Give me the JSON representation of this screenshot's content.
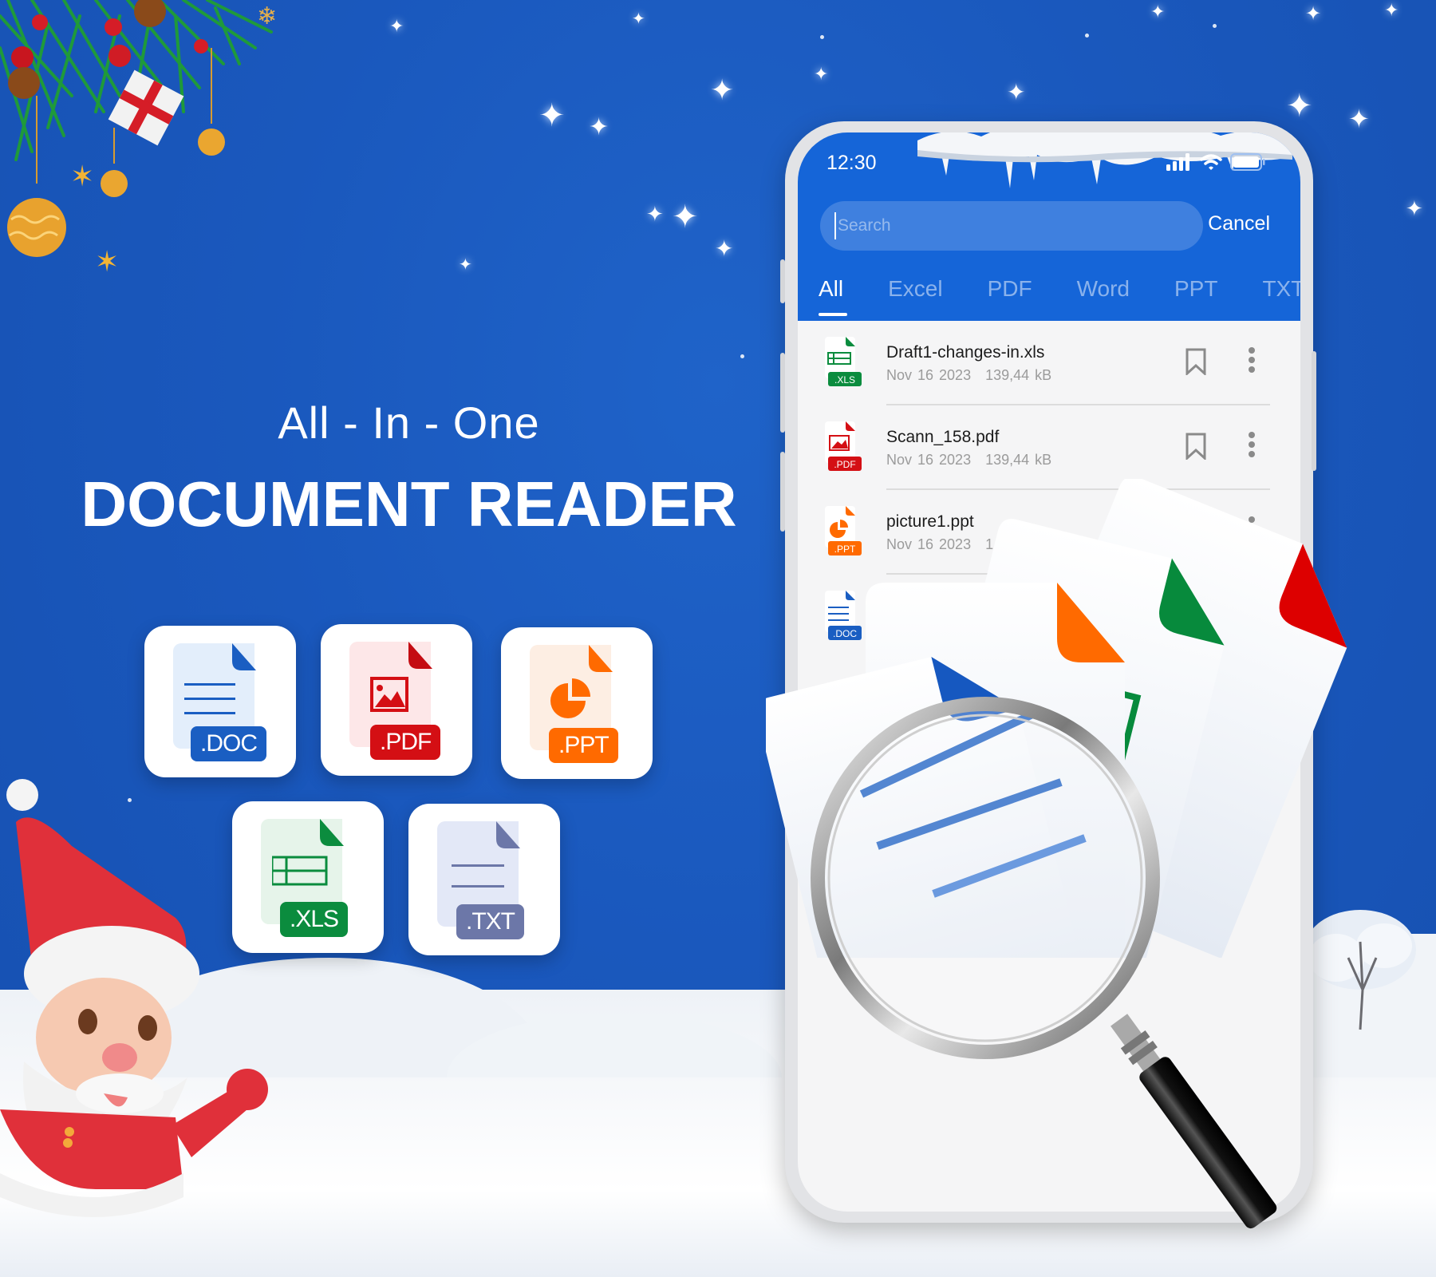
{
  "promo": {
    "tagline": "All - In - One",
    "headline": "DOCUMENT READER"
  },
  "formats": [
    {
      "label": ".DOC",
      "type": "doc",
      "color": "#1a5ec2",
      "tint": "#e3eefb"
    },
    {
      "label": ".PDF",
      "type": "pdf",
      "color": "#d40f14",
      "tint": "#fde7e8"
    },
    {
      "label": ".PPT",
      "type": "ppt",
      "color": "#ff6a00",
      "tint": "#fdeee3"
    },
    {
      "label": ".XLS",
      "type": "xls",
      "color": "#0b8c3e",
      "tint": "#e6f4ea"
    },
    {
      "label": ".TXT",
      "type": "txt",
      "color": "#6c77a8",
      "tint": "#e3e8f7"
    }
  ],
  "phone": {
    "status": {
      "time": "12:30",
      "icons": [
        "signal-icon",
        "wifi-icon",
        "battery-icon"
      ]
    },
    "search": {
      "placeholder": "Search",
      "value": "",
      "cancel_label": "Cancel"
    },
    "tabs": [
      {
        "label": "All",
        "active": true
      },
      {
        "label": "Excel",
        "active": false
      },
      {
        "label": "PDF",
        "active": false
      },
      {
        "label": "Word",
        "active": false
      },
      {
        "label": "PPT",
        "active": false
      },
      {
        "label": "TXT",
        "active": false
      }
    ],
    "files": [
      {
        "name": "Draft1-changes-in.xls",
        "date": "Nov 16 2023",
        "size": "139,44 kB",
        "type": "xls",
        "badge": ".XLS"
      },
      {
        "name": "Scann_158.pdf",
        "date": "Nov 16 2023",
        "size": "139,44 kB",
        "type": "pdf",
        "badge": ".PDF"
      },
      {
        "name": "picture1.ppt",
        "date": "Nov 16 2023",
        "size": "1",
        "type": "ppt",
        "badge": ".PPT"
      },
      {
        "name": "",
        "date": "",
        "size": "",
        "type": "doc",
        "badge": ".DOC"
      }
    ]
  },
  "colors": {
    "background": "#1a58bd",
    "header": "#1565d8",
    "xls": "#0b8c3e",
    "pdf": "#d40f14",
    "ppt": "#ff6a00",
    "doc": "#1a5ec2",
    "txt": "#6c77a8"
  }
}
